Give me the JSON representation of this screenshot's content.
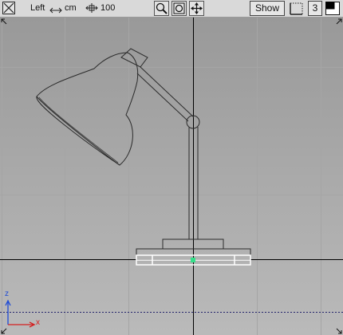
{
  "toolbar": {
    "view_name": "Left",
    "units_label": "cm",
    "units_icon": "horizontal-double-arrow-icon",
    "zoom_value": "100",
    "zoom_icon": "crosshair-arrows-icon",
    "tools": [
      "magnifier-icon",
      "frame-all-icon",
      "pan-arrows-icon"
    ],
    "show_label": "Show",
    "layout_number": "3"
  },
  "axes": {
    "z_label": "z",
    "x_label": "x",
    "z_color": "#1e4bd6",
    "x_color": "#d42020"
  },
  "colors": {
    "background_top": "#9a9a9a",
    "background_bottom": "#b9b9b9",
    "grid_line": "#a8a8a8",
    "axis_line": "#000000",
    "model_wire": "#2b2b2b",
    "selection": "#ffffff",
    "pivot_marker": "#35e08a"
  }
}
